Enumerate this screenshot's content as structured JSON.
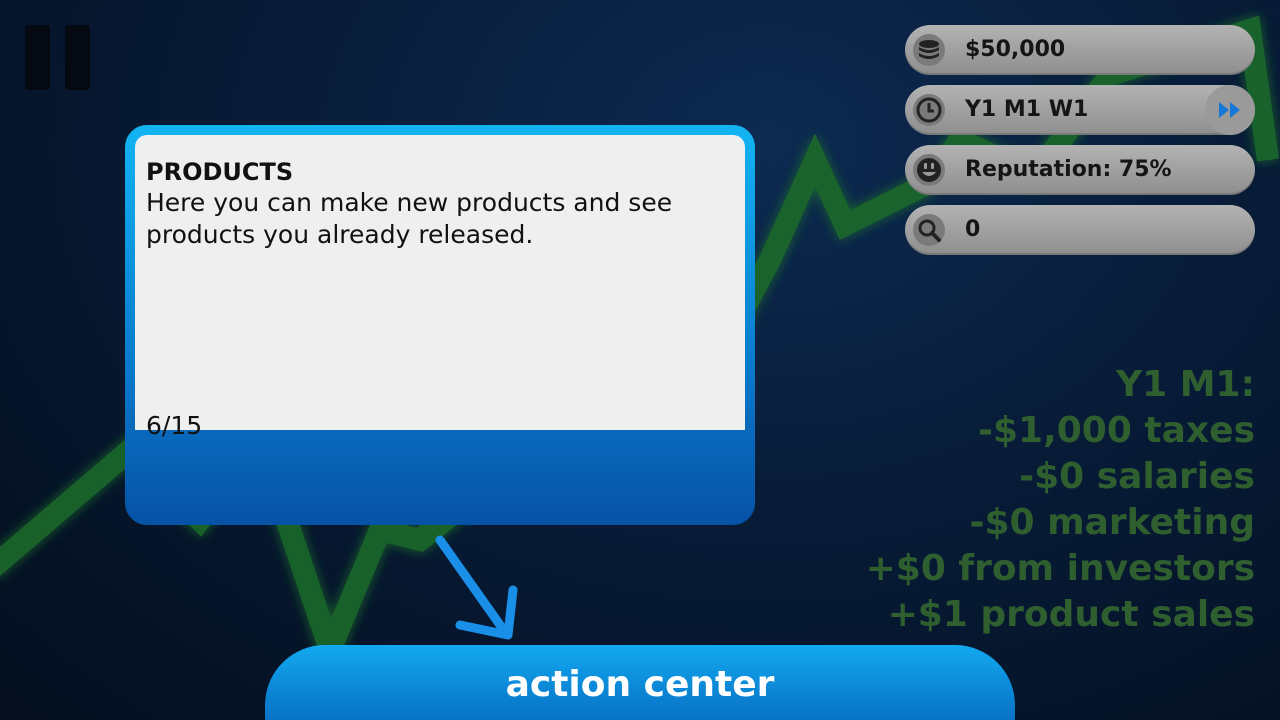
{
  "hud": {
    "money": "$50,000",
    "date": "Y1 M1 W1",
    "reputation": "Reputation: 75%",
    "search_count": "0"
  },
  "tutorial": {
    "title": "PRODUCTS",
    "body": "Here you can make new products and see products you already released.",
    "step": "6/15"
  },
  "summary": {
    "lines": [
      "Y1 M1:",
      "-$1,000 taxes",
      "-$0 salaries",
      "-$0 marketing",
      "+$0 from investors",
      "+$1 product sales"
    ]
  },
  "action_button": {
    "label": "action center"
  },
  "icons": {
    "pause": "pause-icon",
    "money": "coins-icon",
    "date": "clock-icon",
    "reputation": "smiley-face-icon",
    "search": "magnifier-icon",
    "fast_forward": "fast-forward-icon",
    "pointer": "arrow-icon"
  },
  "colors": {
    "accent_blue": "#0a7fd0",
    "graph_green": "#1f6a2a",
    "summary_green": "#2f5e2f",
    "pill_gray": "#a0a0a0",
    "fast_forward_blue": "#1577d6"
  }
}
